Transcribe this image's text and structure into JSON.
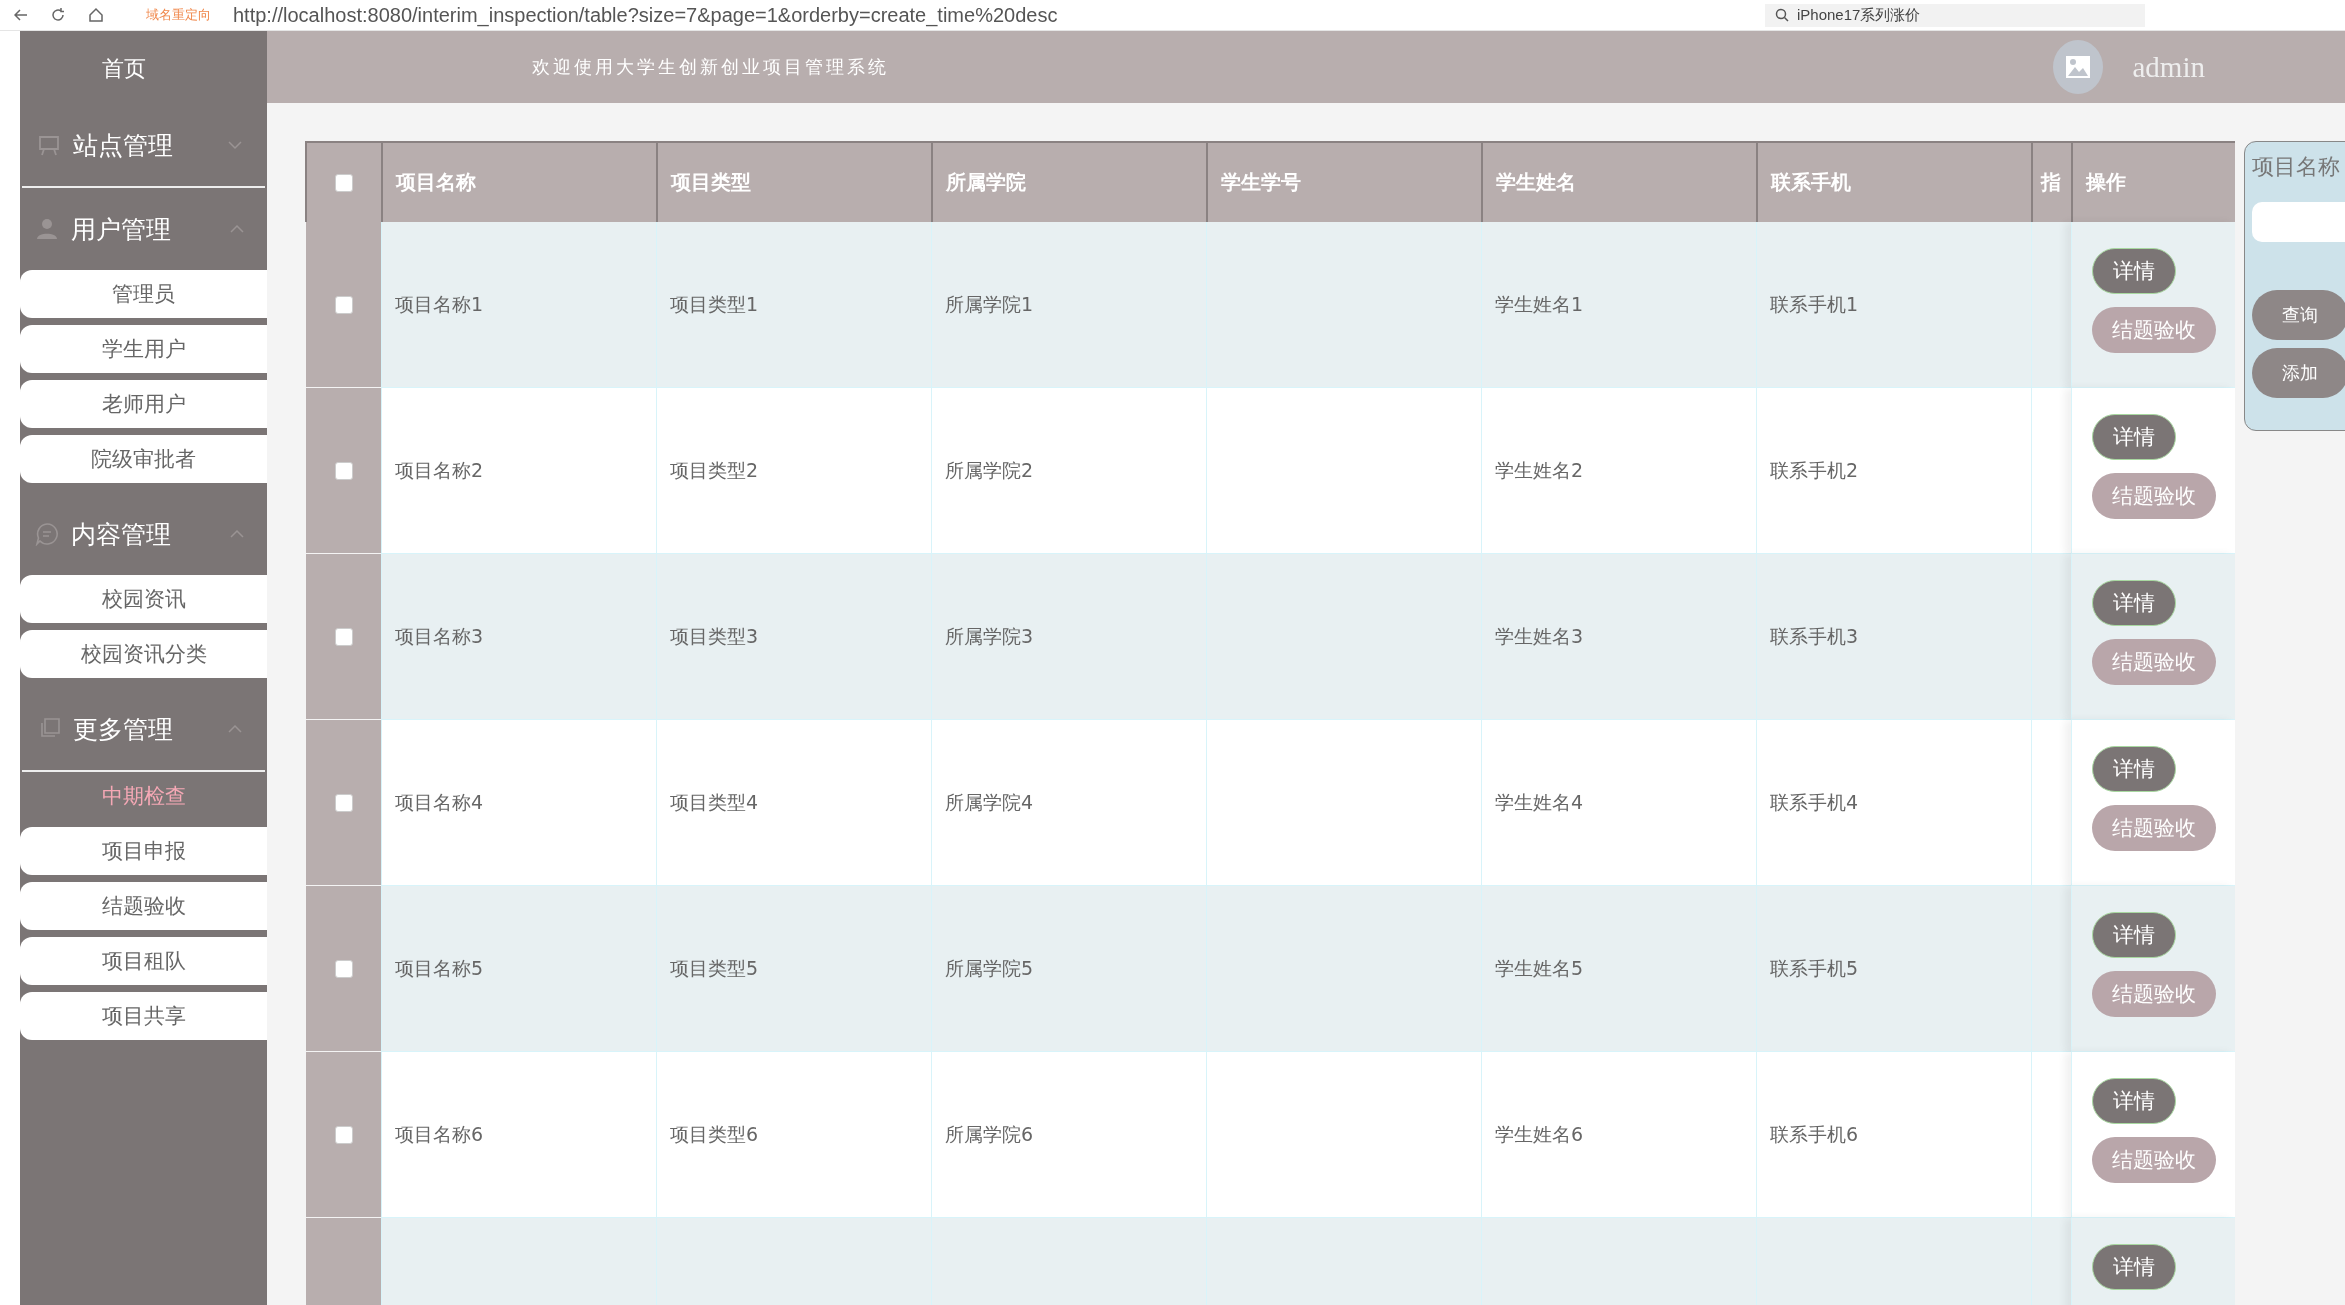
{
  "browser": {
    "redirect_label": "域名重定向",
    "url": "http://localhost:8080/interim_inspection/table?size=7&page=1&orderby=create_time%20desc",
    "search": "iPhone17系列涨价"
  },
  "sidebar": {
    "home": "首页",
    "groups": [
      {
        "label": "站点管理",
        "kind": "board",
        "expanded": false
      },
      {
        "label": "用户管理",
        "kind": "user",
        "expanded": true,
        "items": [
          {
            "label": "管理员",
            "selected": false
          },
          {
            "label": "学生用户",
            "selected": false
          },
          {
            "label": "老师用户",
            "selected": false
          },
          {
            "label": "院级审批者",
            "selected": false
          }
        ]
      },
      {
        "label": "内容管理",
        "kind": "chat",
        "expanded": true,
        "items": [
          {
            "label": "校园资讯",
            "selected": false
          },
          {
            "label": "校园资讯分类",
            "selected": false
          }
        ]
      },
      {
        "label": "更多管理",
        "kind": "copy",
        "expanded": true,
        "items": [
          {
            "label": "中期检查",
            "selected": true
          },
          {
            "label": "项目申报",
            "selected": false
          },
          {
            "label": "结题验收",
            "selected": false
          },
          {
            "label": "项目租队",
            "selected": false
          },
          {
            "label": "项目共享",
            "selected": false
          }
        ]
      }
    ]
  },
  "header": {
    "title": "欢迎使用大学生创新创业项目管理系统",
    "user": "admin"
  },
  "table": {
    "select_all_checked": false,
    "columns": [
      "项目名称",
      "项目类型",
      "所属学院",
      "学生学号",
      "学生姓名",
      "联系手机",
      "指",
      "操作"
    ],
    "rows": [
      {
        "checked": false,
        "cells": [
          "项目名称1",
          "项目类型1",
          "所属学院1",
          "",
          "学生姓名1",
          "联系手机1",
          ""
        ],
        "actions": [
          "详情",
          "结题验收"
        ]
      },
      {
        "checked": false,
        "cells": [
          "项目名称2",
          "项目类型2",
          "所属学院2",
          "",
          "学生姓名2",
          "联系手机2",
          ""
        ],
        "actions": [
          "详情",
          "结题验收"
        ]
      },
      {
        "checked": false,
        "cells": [
          "项目名称3",
          "项目类型3",
          "所属学院3",
          "",
          "学生姓名3",
          "联系手机3",
          ""
        ],
        "actions": [
          "详情",
          "结题验收"
        ]
      },
      {
        "checked": false,
        "cells": [
          "项目名称4",
          "项目类型4",
          "所属学院4",
          "",
          "学生姓名4",
          "联系手机4",
          ""
        ],
        "actions": [
          "详情",
          "结题验收"
        ]
      },
      {
        "checked": false,
        "cells": [
          "项目名称5",
          "项目类型5",
          "所属学院5",
          "",
          "学生姓名5",
          "联系手机5",
          ""
        ],
        "actions": [
          "详情",
          "结题验收"
        ]
      },
      {
        "checked": false,
        "cells": [
          "项目名称6",
          "项目类型6",
          "所属学院6",
          "",
          "学生姓名6",
          "联系手机6",
          ""
        ],
        "actions": [
          "详情",
          "结题验收"
        ]
      },
      {
        "actions": [
          "详情"
        ]
      }
    ]
  },
  "search_panel": {
    "label": "项目名称",
    "buttons": [
      "查询",
      "添加"
    ]
  }
}
